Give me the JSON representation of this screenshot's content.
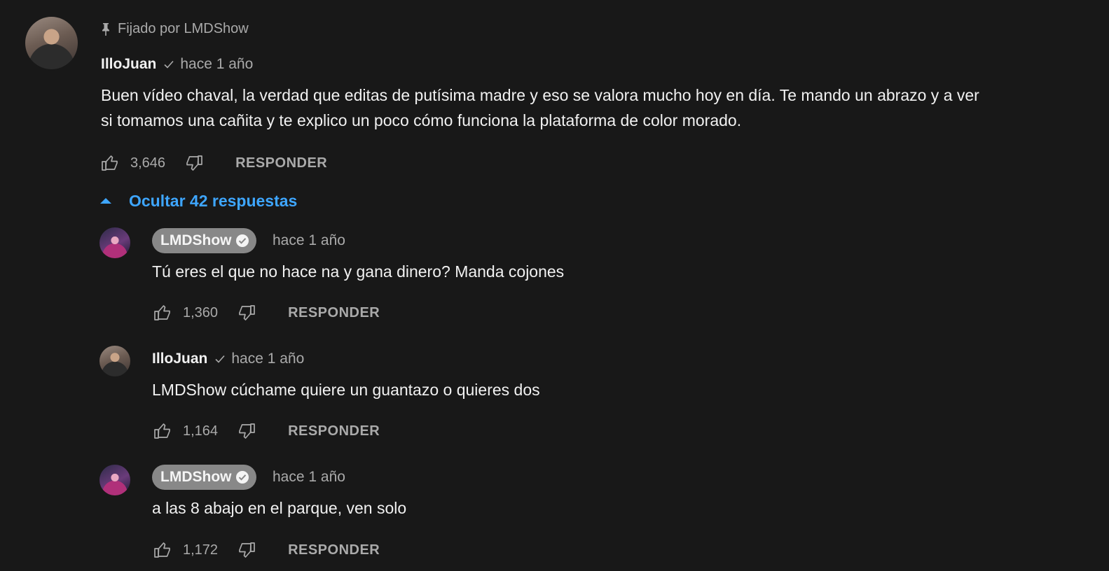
{
  "pinned": {
    "pin_icon": "pin-icon",
    "label": "Fijado por LMDShow"
  },
  "main_comment": {
    "author": "IlloJuan",
    "verified_icon": "check-icon",
    "timestamp": "hace 1 año",
    "text_line1": "Buen vídeo chaval, la verdad que editas de putísima madre y eso se valora mucho hoy en día. Te mando un abrazo y a ver",
    "text_line2": "si tomamos una cañita y te explico un poco cómo funciona la plataforma de color morado.",
    "likes": "3,646",
    "reply_label": "RESPONDER"
  },
  "replies_toggle": {
    "icon": "caret-up-icon",
    "label": "Ocultar 42 respuestas"
  },
  "replies": [
    {
      "author": "LMDShow",
      "is_owner": true,
      "timestamp": "hace 1 año",
      "text": "Tú eres el que no hace na y gana dinero? Manda cojones",
      "likes": "1,360",
      "reply_label": "RESPONDER"
    },
    {
      "author": "IlloJuan",
      "is_owner": false,
      "timestamp": "hace 1 año",
      "text": "LMDShow cúchame quiere un guantazo o quieres dos",
      "likes": "1,164",
      "reply_label": "RESPONDER"
    },
    {
      "author": "LMDShow",
      "is_owner": true,
      "timestamp": "hace 1 año",
      "text": "a las 8 abajo en el parque, ven solo",
      "likes": "1,172",
      "reply_label": "RESPONDER"
    }
  ],
  "colors": {
    "background": "#181818",
    "link_blue": "#3ea6ff",
    "secondary_text": "#aaaaaa",
    "owner_chip": "#888888"
  }
}
